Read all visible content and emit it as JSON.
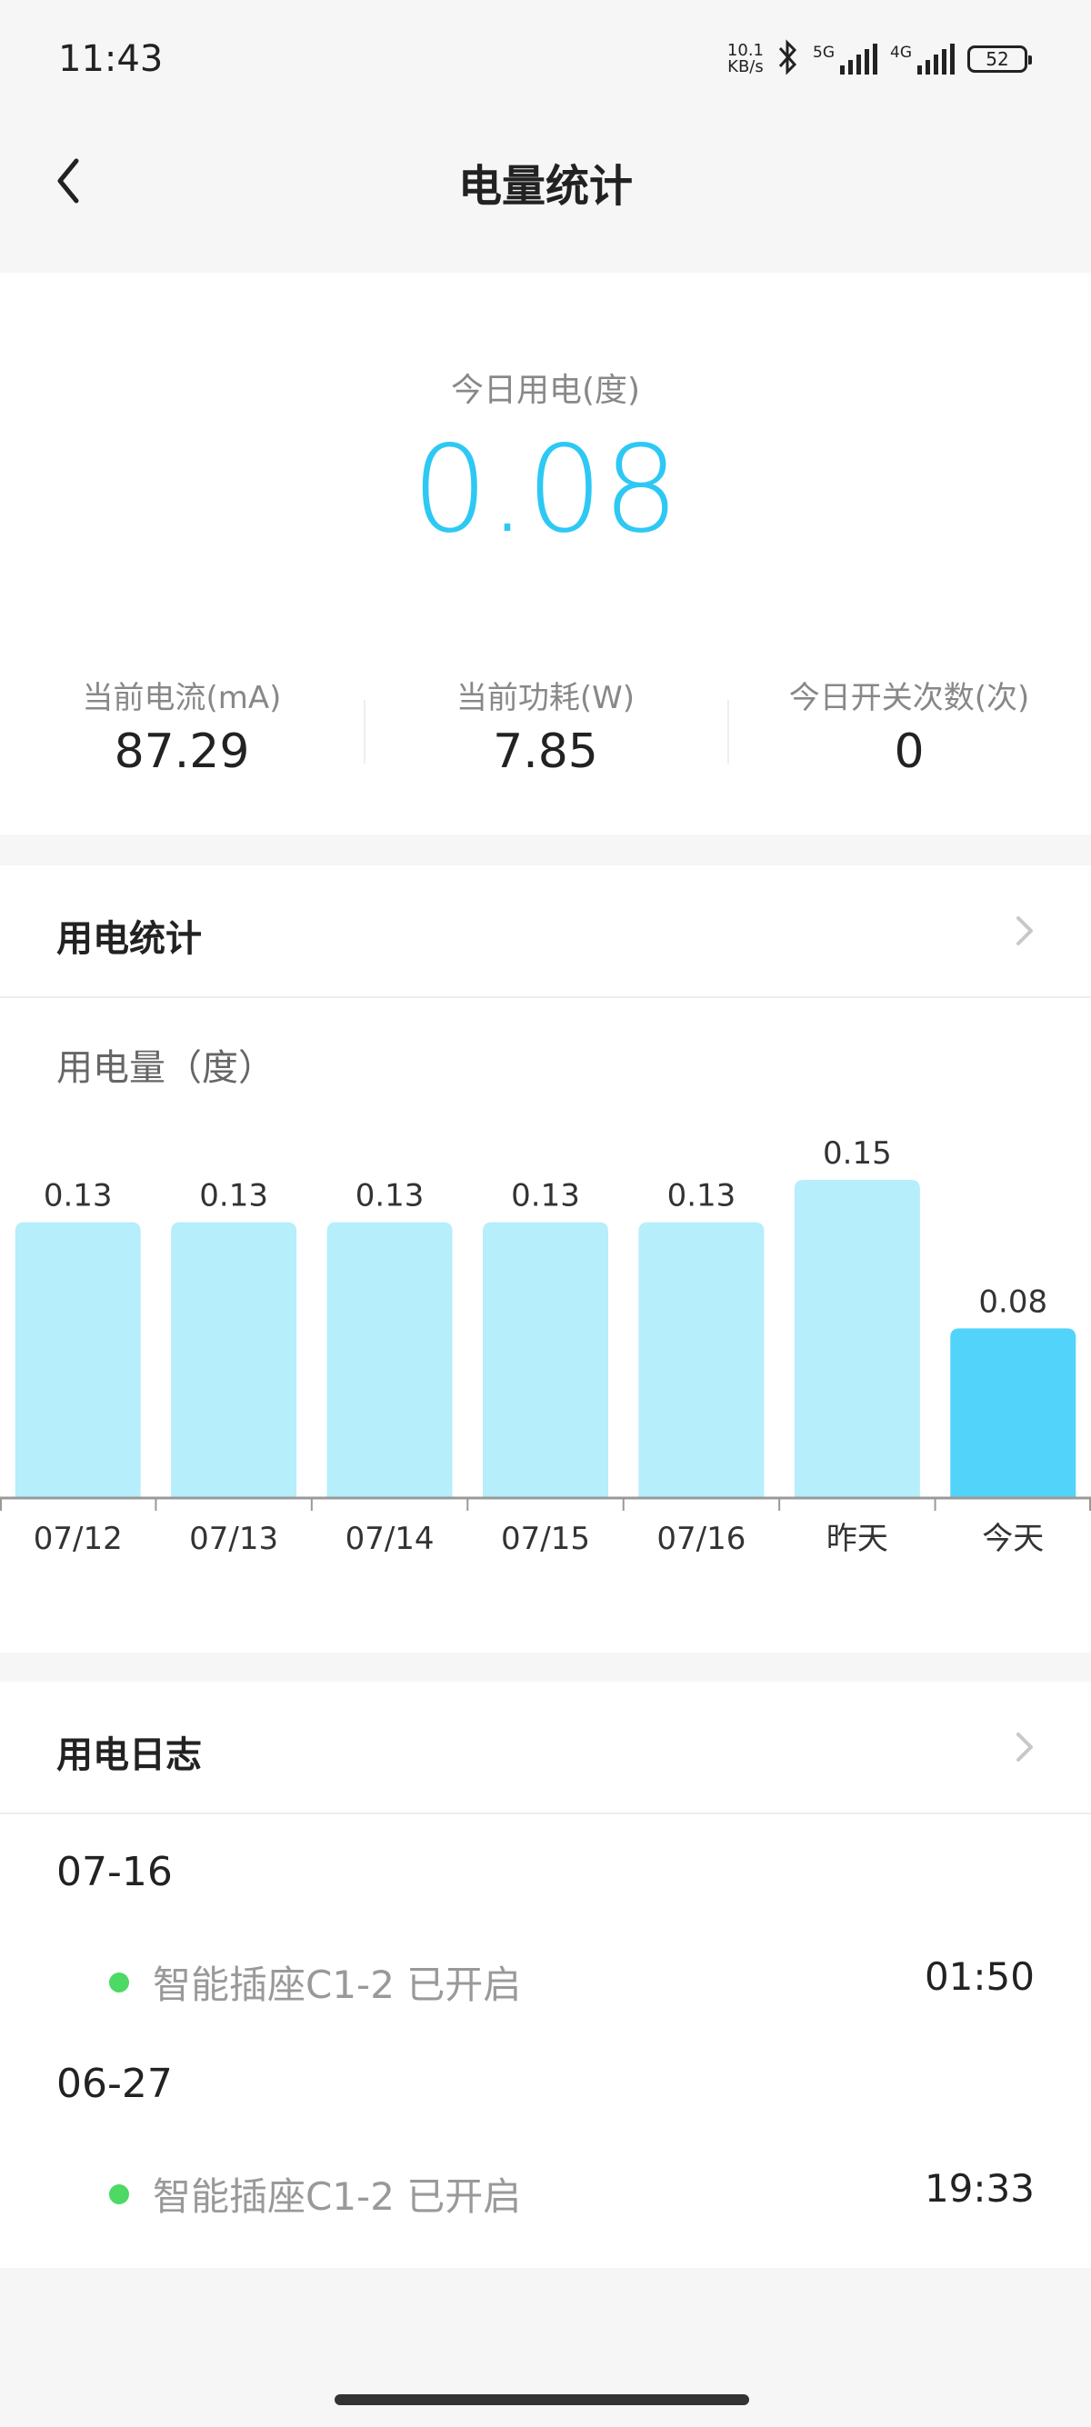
{
  "status_bar": {
    "time": "11:43",
    "net_speed_value": "10.1",
    "net_speed_unit": "KB/s",
    "sim1_label": "5G",
    "sim2_label": "4G",
    "battery": "52"
  },
  "header": {
    "title": "电量统计"
  },
  "summary": {
    "today_label": "今日用电(度)",
    "today_value": "0.08",
    "stats": [
      {
        "label": "当前电流(mA)",
        "value": "87.29"
      },
      {
        "label": "当前功耗(W)",
        "value": "7.85"
      },
      {
        "label": "今日开关次数(次)",
        "value": "0"
      }
    ]
  },
  "energy_section": {
    "title": "用电统计",
    "chart_title": "用电量（度）"
  },
  "chart_data": {
    "type": "bar",
    "categories": [
      "07/12",
      "07/13",
      "07/14",
      "07/15",
      "07/16",
      "昨天",
      "今天"
    ],
    "values": [
      0.13,
      0.13,
      0.13,
      0.13,
      0.13,
      0.15,
      0.08
    ],
    "value_labels": [
      "0.13",
      "0.13",
      "0.13",
      "0.13",
      "0.13",
      "0.15",
      "0.08"
    ],
    "title": "用电量（度）",
    "highlight_index": 6,
    "colors": {
      "normal": "#b6eefc",
      "highlight": "#52d4fa",
      "axis": "#999999"
    },
    "grid": false
  },
  "log_section": {
    "title": "用电日志",
    "groups": [
      {
        "date": "07-16",
        "entries": [
          {
            "text": "智能插座C1-2 已开启",
            "time": "01:50"
          }
        ]
      },
      {
        "date": "06-27",
        "entries": [
          {
            "text": "智能插座C1-2 已开启",
            "time": "19:33"
          }
        ]
      }
    ],
    "dot_color": "#4cd964"
  },
  "icons": {
    "back": "chevron-left-icon",
    "chevron": "chevron-right-icon",
    "bluetooth": "bluetooth-icon"
  }
}
